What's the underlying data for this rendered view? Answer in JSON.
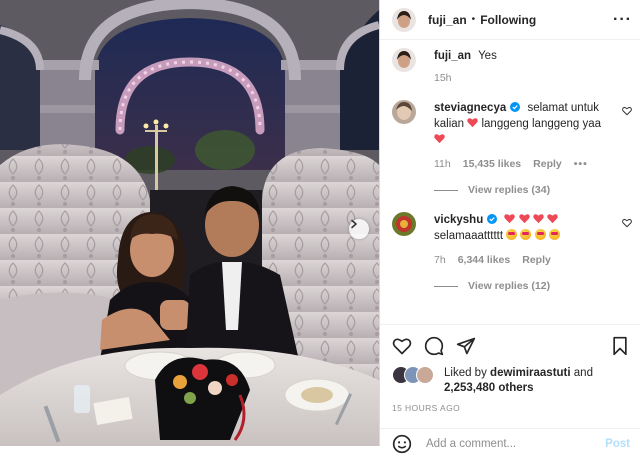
{
  "post": {
    "author": "fuji_an",
    "follow_status": "Following",
    "separator": "•",
    "photo_alt": "Couple seated on a floral banquette at a candlelit dinner table under an arched window"
  },
  "comments": [
    {
      "user": "fuji_an",
      "text": "Yes",
      "time": "15h",
      "verified": false
    },
    {
      "user": "steviagnecya",
      "text_a": "selamat untuk kalian",
      "text_b": "langgeng langgeng yaa",
      "time": "11h",
      "likes": "15,435 likes",
      "reply": "Reply",
      "more": "•••",
      "view_replies": "View replies (34)",
      "verified": true
    },
    {
      "user": "vickyshu",
      "text_a": "selamaaatttttt",
      "time": "7h",
      "likes": "6,344 likes",
      "reply": "Reply",
      "view_replies": "View replies (12)",
      "verified": true
    }
  ],
  "likes": {
    "prefix": "Liked by",
    "user": "dewimiraastuti",
    "conj": "and",
    "others": "2,253,480 others"
  },
  "timestamp": "15 HOURS AGO",
  "add_comment": {
    "placeholder": "Add a comment...",
    "post_label": "Post"
  },
  "colors": {
    "heart_red": "#ed4956",
    "verified_blue": "#0095f6",
    "muted": "#8e8e8e"
  }
}
